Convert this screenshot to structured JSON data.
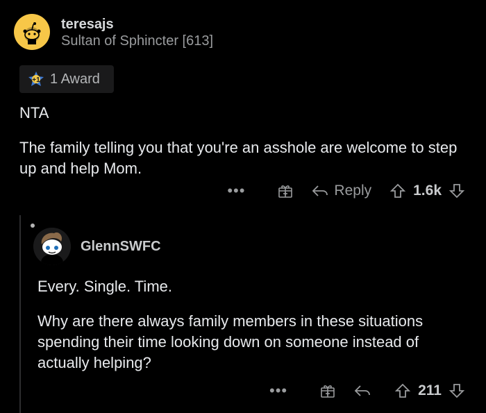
{
  "comment": {
    "username": "teresajs",
    "flair": "Sultan of Sphincter [613]",
    "award_label": "1 Award",
    "paragraphs": [
      "NTA",
      "The family telling you that you're an asshole are welcome to step up and help Mom."
    ],
    "actions": {
      "more": "•••",
      "reply_label": "Reply",
      "score": "1.6k"
    }
  },
  "reply": {
    "username": "GlennSWFC",
    "paragraphs": [
      "Every. Single. Time.",
      "Why are there always family members in these situations spending their time looking down on someone instead of actually helping?"
    ],
    "actions": {
      "more": "•••",
      "score": "211"
    }
  },
  "colors": {
    "background": "#000000",
    "avatar_yellow": "#f7c748",
    "muted_text": "#9a9c9e"
  },
  "icons": [
    "snoo-avatar-icon",
    "award-icon",
    "more-icon",
    "gift-icon",
    "reply-arrow-icon",
    "upvote-icon",
    "downvote-icon"
  ]
}
